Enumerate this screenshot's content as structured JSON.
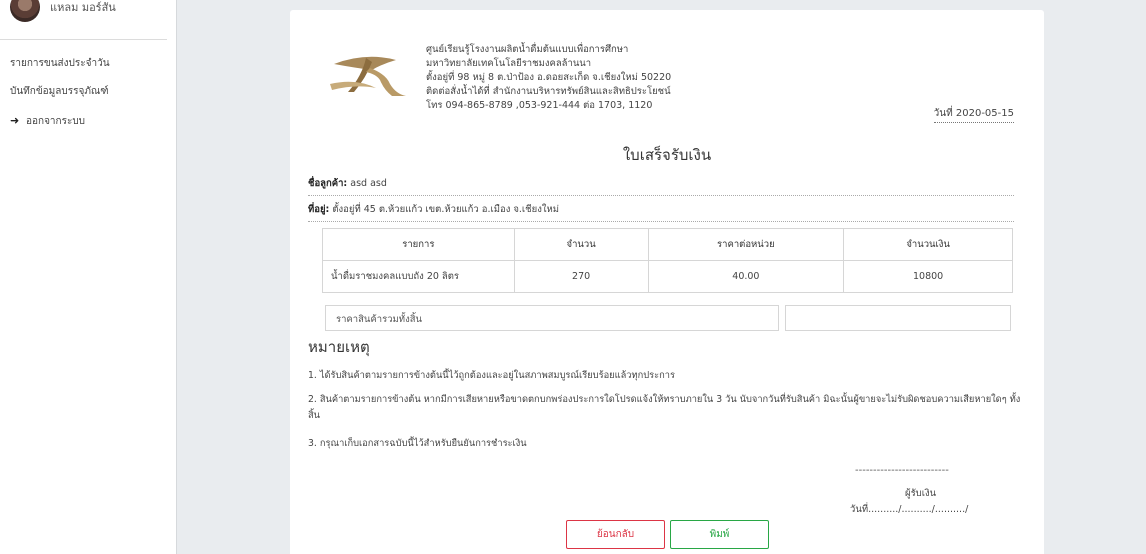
{
  "sidebar": {
    "user_name": "แหลม มอร์สัน",
    "items": [
      {
        "label": "รายการขนส่งประจำวัน"
      },
      {
        "label": "บันทึกข้อมูลบรรจุภัณฑ์"
      },
      {
        "label": "ออกจากระบบ",
        "icon": "sign-out-icon"
      }
    ]
  },
  "receipt": {
    "header_lines": [
      "ศูนย์เรียนรู้โรงงานผลิตน้ำดื่มต้นแบบเพื่อการศึกษา",
      "มหาวิทยาลัยเทคโนโลยีราชมงคลล้านนา",
      "ตั้งอยู่ที่ 98 หมู่ 8 ต.ป่าป้อง อ.ดอยสะเก็ด จ.เชียงใหม่ 50220",
      "ติดต่อสั่งน้ำได้ที่ สำนักงานบริหารทรัพย์สินและสิทธิประโยชน์",
      "โทร 094-865-8789 ,053-921-444 ต่อ 1703, 1120"
    ],
    "date": "วันที่ 2020-05-15",
    "title": "ใบเสร็จรับเงิน",
    "customer_label": "ชื่อลูกค้า:",
    "customer_value": "asd asd",
    "address_label": "ที่อยู่:",
    "address_value": "ตั้งอยู่ที่ 45 ต.ห้วยแก้ว เขต.ห้วยแก้ว อ.เมือง จ.เชียงใหม่",
    "table": {
      "headers": [
        "รายการ",
        "จำนวน",
        "ราคาต่อหน่วย",
        "จำนวนเงิน"
      ],
      "rows": [
        [
          "น้ำดื่มราชมงคลแบบถัง 20 ลิตร",
          "270",
          "40.00",
          "10800"
        ]
      ]
    },
    "total_label": "ราคาสินค้ารวมทั้งสิ้น",
    "total_value": "",
    "notes_title": "หมายเหตุ",
    "notes": [
      "1. ได้รับสินค้าตามรายการข้างต้นนี้ไว้ถูกต้องและอยู่ในสภาพสมบูรณ์เรียบร้อยแล้วทุกประการ",
      "2. สินค้าตามรายการข้างต้น หากมีการเสียหายหรือขาดตกบกพร่องประการใดโปรดแจ้งให้ทราบภายใน 3 วัน นับจากวันที่รับสินค้า มิฉะนั้นผู้ขายจะไม่รับผิดชอบความเสียหายใดๆ ทั้งสิ้น",
      "3. กรุณาเก็บเอกสารฉบับนี้ไว้สำหรับยืนยันการชำระเงิน"
    ],
    "signature_line": "--------------------------",
    "signature_label": "ผู้รับเงิน",
    "signature_date": "วันที่........../........../........../"
  },
  "buttons": {
    "back": "ย้อนกลับ",
    "print": "พิมพ์"
  },
  "colors": {
    "back_button": "#dc3545",
    "print_button": "#28a745",
    "logo_gold": "#a8895a"
  }
}
